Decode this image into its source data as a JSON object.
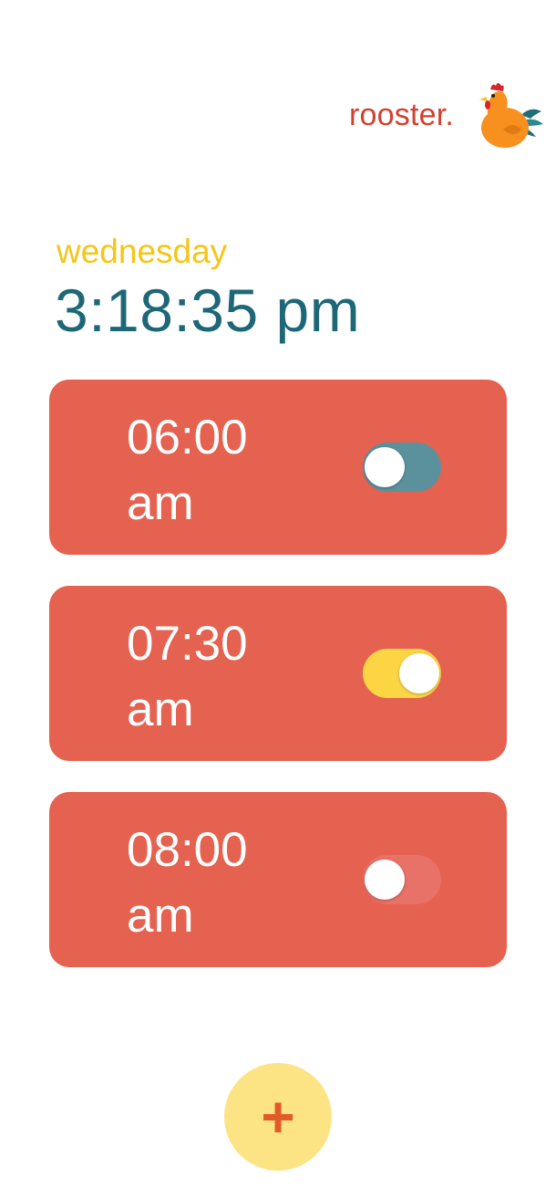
{
  "header": {
    "brand": "rooster.",
    "logo_icon": "rooster-icon"
  },
  "clock": {
    "day": "wednesday",
    "time": "3:18:35 pm"
  },
  "alarms": [
    {
      "time": "06:00",
      "period": "am",
      "toggle_state": "off",
      "toggle_color": "#5b919c"
    },
    {
      "time": "07:30",
      "period": "am",
      "toggle_state": "on",
      "toggle_color": "#fcd545"
    },
    {
      "time": "08:00",
      "period": "am",
      "toggle_state": "off",
      "toggle_color": "#e87168"
    }
  ],
  "add_button": {
    "label": "+"
  },
  "colors": {
    "brand": "#d3402f",
    "day": "#f5c518",
    "clock": "#1d6777",
    "card": "#e56150",
    "add_button_bg": "#fce485",
    "add_button_fg": "#e25a28"
  }
}
